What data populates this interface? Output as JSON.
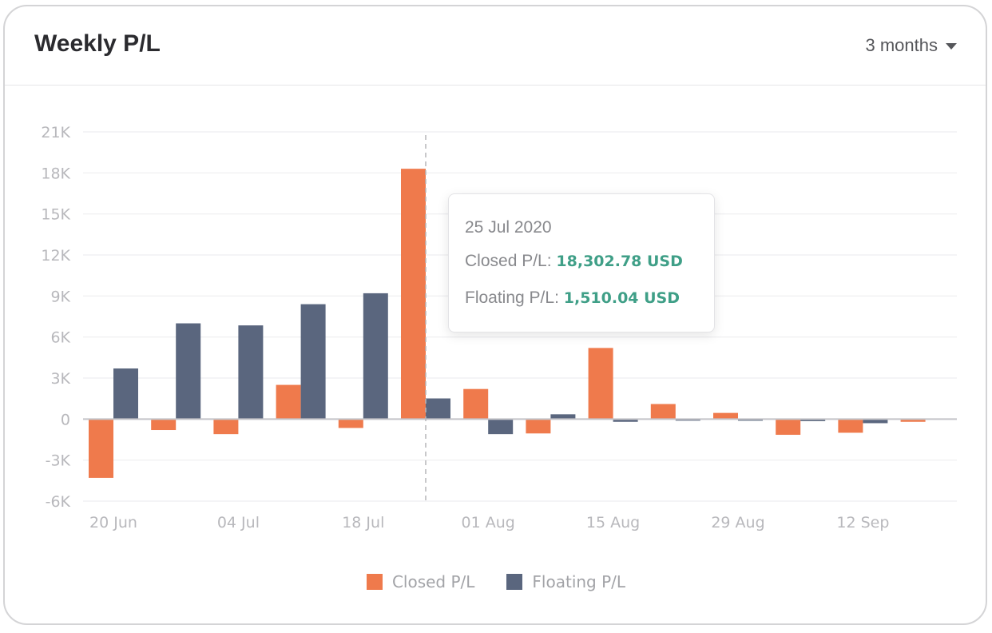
{
  "card": {
    "title": "Weekly P/L",
    "range_selector": {
      "selected": "3 months"
    }
  },
  "tooltip": {
    "date": "25 Jul 2020",
    "closed_label": "Closed P/L:",
    "closed_value": "18,302.78 USD",
    "floating_label": "Floating P/L:",
    "floating_value": "1,510.04 USD"
  },
  "colors": {
    "closed": "#ef7a4c",
    "floating": "#5a667e",
    "tooltip_value": "#3f9f87"
  },
  "chart_data": {
    "type": "bar",
    "title": "Weekly P/L",
    "xlabel": "",
    "ylabel": "",
    "ylim": [
      -6000,
      21000
    ],
    "yticks": [
      -6000,
      -3000,
      0,
      3000,
      6000,
      9000,
      12000,
      15000,
      18000,
      21000
    ],
    "ytick_labels": [
      "-6K",
      "-3K",
      "0",
      "3K",
      "6K",
      "9K",
      "12K",
      "15K",
      "18K",
      "21K"
    ],
    "grid": true,
    "legend_position": "bottom-center",
    "categories": [
      "20 Jun",
      "27 Jun",
      "04 Jul",
      "11 Jul",
      "18 Jul",
      "25 Jul",
      "01 Aug",
      "08 Aug",
      "15 Aug",
      "22 Aug",
      "29 Aug",
      "05 Sep",
      "12 Sep",
      "19 Sep"
    ],
    "xtick_labels": [
      "20 Jun",
      "04 Jul",
      "18 Jul",
      "01 Aug",
      "15 Aug",
      "29 Aug",
      "12 Sep"
    ],
    "series": [
      {
        "name": "Closed P/L",
        "values": [
          -4300,
          -800,
          -1100,
          2500,
          -650,
          18302.78,
          2200,
          -1050,
          5200,
          1100,
          450,
          -1150,
          -1000,
          -200
        ]
      },
      {
        "name": "Floating P/L",
        "values": [
          3700,
          7000,
          6850,
          8400,
          9200,
          1510.04,
          -1100,
          350,
          -200,
          -50,
          -120,
          -150,
          -300,
          0
        ]
      }
    ],
    "highlighted_category": "25 Jul"
  }
}
